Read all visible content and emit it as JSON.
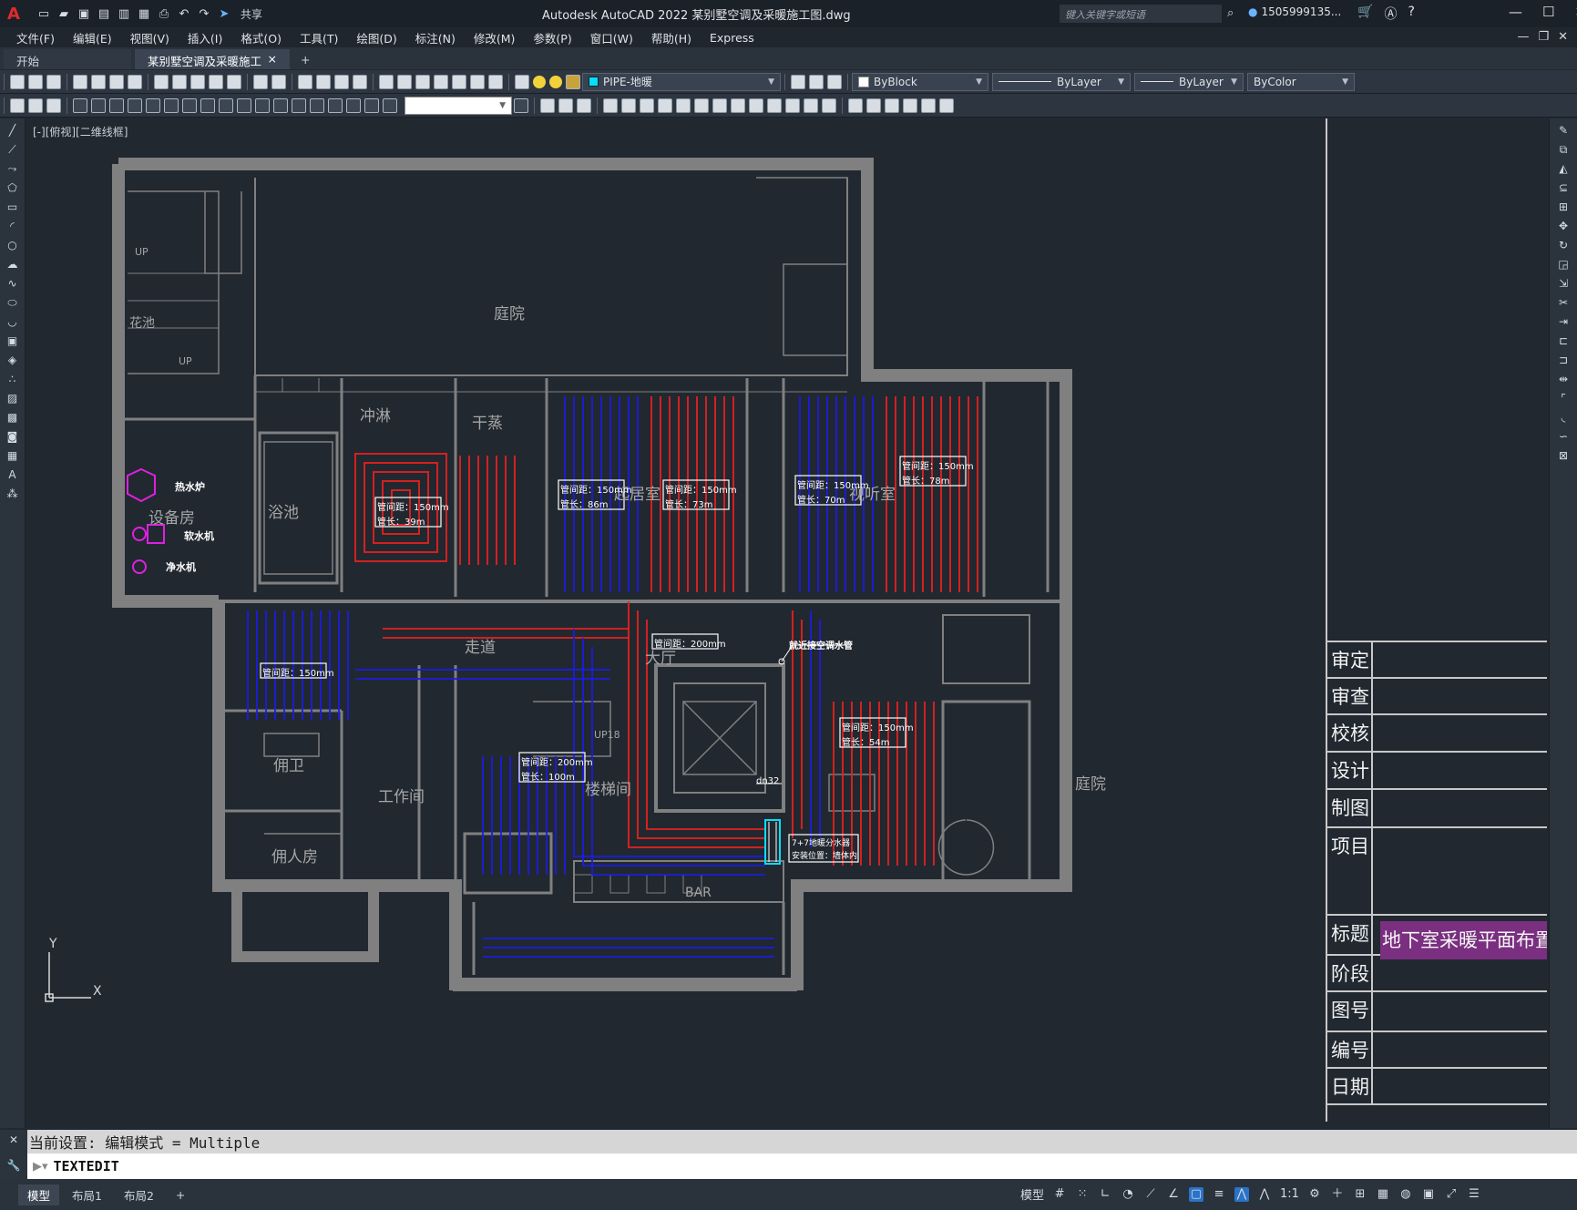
{
  "app": {
    "logo": "A",
    "title": "Autodesk AutoCAD 2022    某别墅空调及采暖施工图.dwg",
    "share_label": "共享",
    "search_placeholder": "键入关键字或短语",
    "user": "1505999135..."
  },
  "menu": [
    "文件(F)",
    "编辑(E)",
    "视图(V)",
    "插入(I)",
    "格式(O)",
    "工具(T)",
    "绘图(D)",
    "标注(N)",
    "修改(M)",
    "参数(P)",
    "窗口(W)",
    "帮助(H)",
    "Express"
  ],
  "tabs": {
    "start": "开始",
    "active": "某别墅空调及采暖施工图*",
    "close": "×",
    "add": "+"
  },
  "properties": {
    "layer": "PIPE-地暖",
    "color": "ByBlock",
    "linetype": "ByLayer",
    "lineweight": "ByLayer",
    "plotstyle": "ByColor"
  },
  "view_label": "[-][俯视][二维线框]",
  "drawing": {
    "rooms": {
      "courtyard_top": "庭院",
      "shower": "冲淋",
      "sauna": "干蒸",
      "bath": "浴池",
      "equipment": "设备房",
      "living": "起居室",
      "av_room": "视听室",
      "corridor": "走道",
      "hall": "大厅",
      "servant_wc": "佣卫",
      "workroom": "工作间",
      "servant_room": "佣人房",
      "stair": "楼梯间",
      "courtyard_right": "庭院",
      "bar": "BAR",
      "flower": "花池",
      "up1": "UP",
      "up2": "UP",
      "up18": "UP18"
    },
    "equipment": {
      "boiler": "热水炉",
      "softener": "软水机",
      "purifier": "净水机"
    },
    "annotations": [
      {
        "id": "bath_spacing",
        "text": "管间距：150mm"
      },
      {
        "id": "bath_length",
        "text": "管长：39m"
      },
      {
        "id": "living_l_spacing",
        "text": "管间距：150mm"
      },
      {
        "id": "living_l_length",
        "text": "管长：86m"
      },
      {
        "id": "living_r_spacing",
        "text": "管间距：150mm"
      },
      {
        "id": "living_r_length",
        "text": "管长：73m"
      },
      {
        "id": "av_l_spacing",
        "text": "管间距：150mm"
      },
      {
        "id": "av_l_length",
        "text": "管长：70m"
      },
      {
        "id": "av_r_spacing",
        "text": "管间距：150mm"
      },
      {
        "id": "av_r_length",
        "text": "管长：78m"
      },
      {
        "id": "corridor_spacing",
        "text": "管间距：150mm"
      },
      {
        "id": "hall_spacing",
        "text": "管间距：200mm"
      },
      {
        "id": "stair_spacing",
        "text": "管间距：200mm"
      },
      {
        "id": "stair_length",
        "text": "管长：100m"
      },
      {
        "id": "east_spacing",
        "text": "管间距：150mm"
      },
      {
        "id": "east_length",
        "text": "管长：54m"
      },
      {
        "id": "ac_note",
        "text": "就近接空调水管"
      },
      {
        "id": "pipe_size",
        "text": "dn32"
      },
      {
        "id": "manifold_1",
        "text": "7+7地暖分水器"
      },
      {
        "id": "manifold_2",
        "text": "安装位置：墙体内"
      }
    ],
    "axis_y": "Y",
    "axis_x": "X"
  },
  "titleblock": {
    "rows": [
      {
        "key": "审定",
        "value": ""
      },
      {
        "key": "审查",
        "value": ""
      },
      {
        "key": "校核",
        "value": ""
      },
      {
        "key": "设计",
        "value": ""
      },
      {
        "key": "制图",
        "value": ""
      },
      {
        "key": "项目",
        "value": ""
      },
      {
        "key": "标题",
        "value": "地下室采暖平面布置图"
      },
      {
        "key": "阶段",
        "value": ""
      },
      {
        "key": "图号",
        "value": ""
      },
      {
        "key": "编号",
        "value": ""
      },
      {
        "key": "日期",
        "value": ""
      }
    ]
  },
  "command": {
    "history": "当前设置: 编辑模式 = Multiple",
    "current": "TEXTEDIT"
  },
  "statusbar": {
    "layouts": [
      "模型",
      "布局1",
      "布局2"
    ],
    "add": "+",
    "model_label": "模型",
    "scale": "1:1"
  },
  "colors": {
    "wall": "#808080",
    "pipe_supply": "#e8201e",
    "pipe_return": "#1c1ce0",
    "equipment": "#e020e0",
    "title_fill": "#7a2f80",
    "background": "#212830"
  }
}
